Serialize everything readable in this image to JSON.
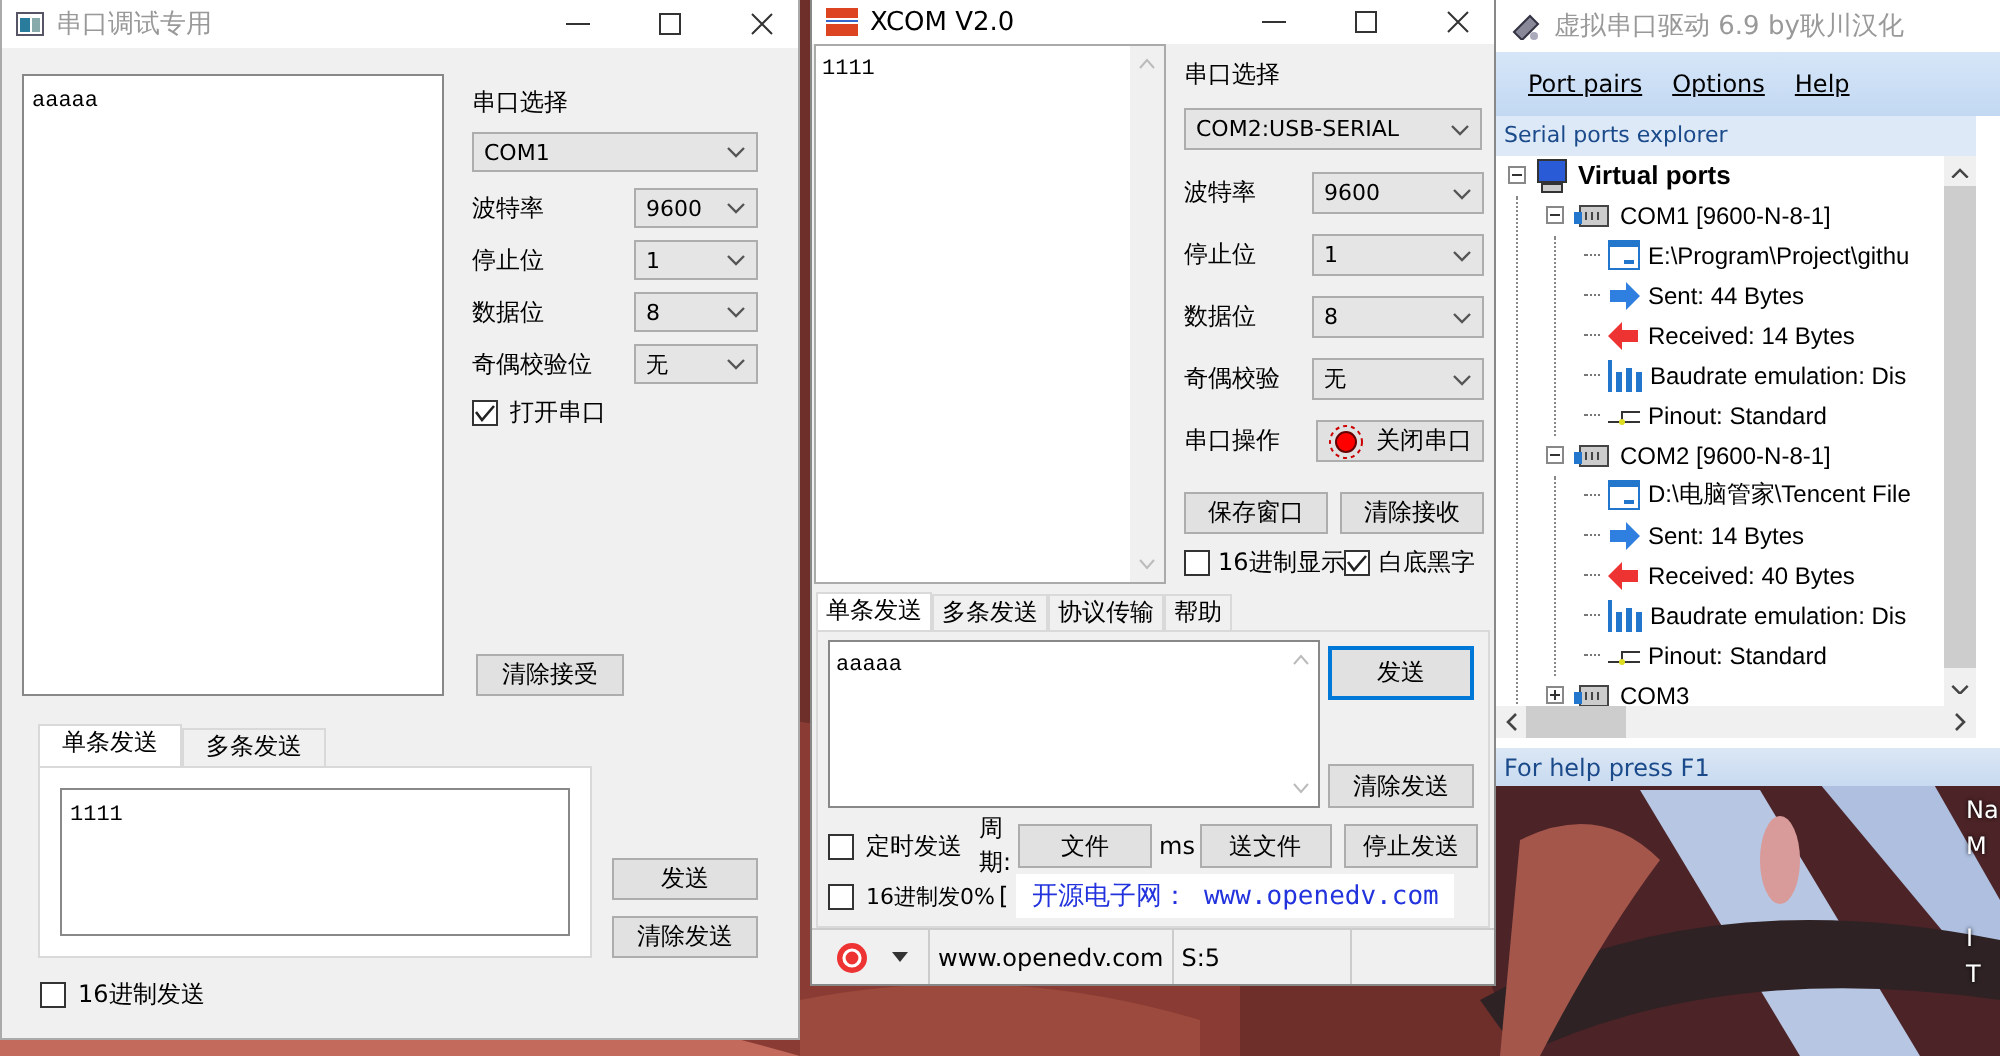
{
  "desktop": {
    "background": {
      "kind": "picture"
    },
    "icon_labels": [
      "Na",
      "M",
      "I",
      "T"
    ]
  },
  "serial_debug_window": {
    "title": "串口调试专用",
    "receive_text": "aaaaa",
    "port_label": "串口选择",
    "port_value": "COM1",
    "settings": [
      {
        "label": "波特率",
        "value": "9600"
      },
      {
        "label": "停止位",
        "value": "1"
      },
      {
        "label": "数据位",
        "value": "8"
      },
      {
        "label": "奇偶校验位",
        "value": "无"
      }
    ],
    "open_port": {
      "label": "打开串口",
      "checked": true
    },
    "clear_receive_button": "清除接受",
    "tabs": [
      {
        "label": "单条发送",
        "selected": true
      },
      {
        "label": "多条发送",
        "selected": false
      }
    ],
    "send_text": "1111",
    "send_button": "发送",
    "clear_send_button": "清除发送",
    "hex_send": {
      "label": "16进制发送",
      "checked": false
    }
  },
  "xcom_window": {
    "title": "XCOM V2.0",
    "receive_text": "1111",
    "port_label": "串口选择",
    "port_value": "COM2:USB-SERIAL",
    "settings": [
      {
        "label": "波特率",
        "value": "9600"
      },
      {
        "label": "停止位",
        "value": "1"
      },
      {
        "label": "数据位",
        "value": "8"
      },
      {
        "label": "奇偶校验",
        "value": "无"
      }
    ],
    "operation": {
      "label": "串口操作",
      "button": "关闭串口"
    },
    "buttons": [
      "保存窗口",
      "清除接收"
    ],
    "display_options": [
      {
        "label": "16进制显示",
        "checked": false
      },
      {
        "label": "白底黑字",
        "checked": true
      }
    ],
    "tabs": [
      {
        "label": "单条发送",
        "selected": true
      },
      {
        "label": "多条发送",
        "selected": false
      },
      {
        "label": "协议传输",
        "selected": false
      },
      {
        "label": "帮助",
        "selected": false
      }
    ],
    "send_text": "aaaaa",
    "send_button": "发送",
    "clear_send_button": "清除发送",
    "timed_send": {
      "label": "定时发送",
      "checked": false
    },
    "period_label": "周期:",
    "open_file_button": "文件",
    "ms_label": "ms",
    "send_file_button": "送文件",
    "stop_send_button": "停止发送",
    "hex_send": {
      "label": "16进制发0%",
      "checked": false
    },
    "bracket": "[",
    "banner": "开源电子网： www.openedv.com",
    "status_bar": {
      "website": "www.openedv.com",
      "sent": "S:5"
    }
  },
  "vspd_window": {
    "title": "虚拟串口驱动 6.9 by耿川汉化",
    "menu": [
      "Port pairs",
      "Options",
      "Help"
    ],
    "explorer_title": "Serial ports explorer",
    "tree": [
      {
        "kind": "root",
        "label": "Virtual ports",
        "expanded": true,
        "children": [
          {
            "kind": "port",
            "label": "COM1 [9600-N-8-1]",
            "expanded": true,
            "children": [
              {
                "kind": "file",
                "label": "E:\\Program\\Project\\githu"
              },
              {
                "kind": "sent",
                "label": "Sent: 44 Bytes"
              },
              {
                "kind": "received",
                "label": "Received: 14 Bytes"
              },
              {
                "kind": "baud",
                "label": "Baudrate emulation: Dis"
              },
              {
                "kind": "pinout",
                "label": "Pinout: Standard"
              }
            ]
          },
          {
            "kind": "port",
            "label": "COM2 [9600-N-8-1]",
            "expanded": true,
            "children": [
              {
                "kind": "file",
                "label": "D:\\电脑管家\\Tencent File"
              },
              {
                "kind": "sent",
                "label": "Sent: 14 Bytes"
              },
              {
                "kind": "received",
                "label": "Received: 40 Bytes"
              },
              {
                "kind": "baud",
                "label": "Baudrate emulation: Dis"
              },
              {
                "kind": "pinout",
                "label": "Pinout: Standard"
              }
            ]
          },
          {
            "kind": "port",
            "label": "COM3",
            "expanded": false
          }
        ]
      }
    ],
    "status_bar": "For help press F1"
  }
}
